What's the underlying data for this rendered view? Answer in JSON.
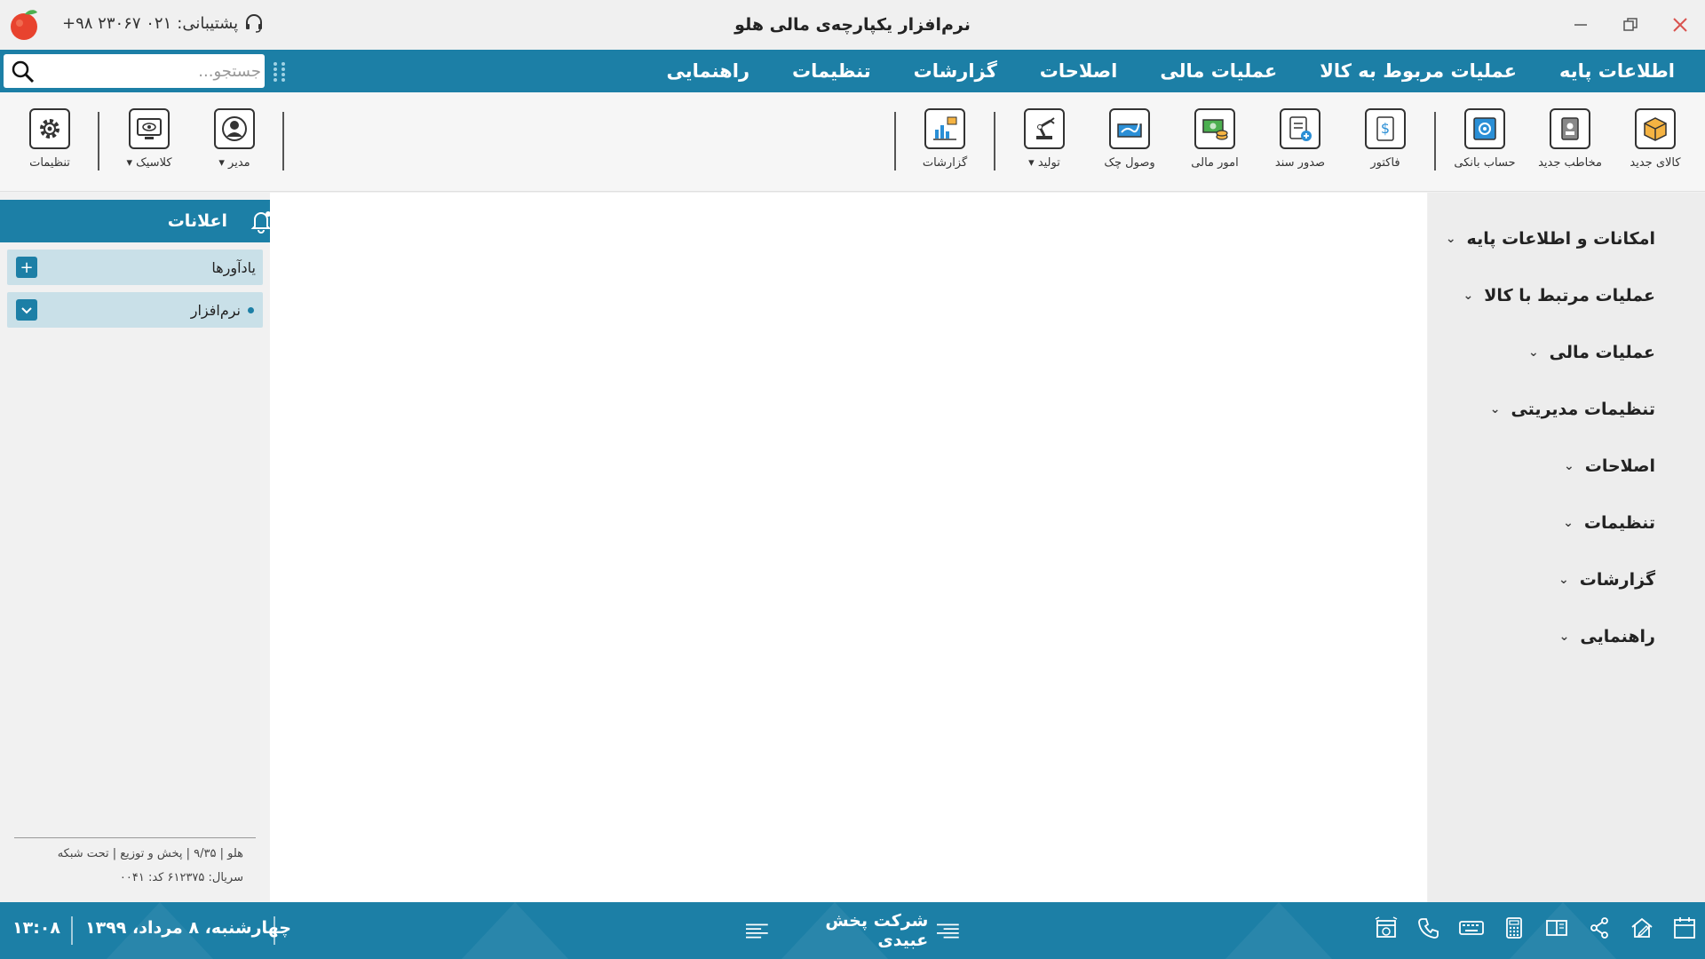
{
  "window": {
    "title": "نرم‌افزار یکپارچه‌ی مالی هلو",
    "support_label": "پشتیبانی:",
    "support_phone": "۰۲۱ ۲۳۰۶۷ ۹۸+"
  },
  "menu": {
    "items": [
      {
        "label": "اطلاعات پایه"
      },
      {
        "label": "عملیات مربوط به کالا"
      },
      {
        "label": "عملیات مالی"
      },
      {
        "label": "اصلاحات"
      },
      {
        "label": "گزارشات"
      },
      {
        "label": "تنظیمات"
      },
      {
        "label": "راهنمایی"
      }
    ],
    "search_placeholder": "جستجو..."
  },
  "toolbar": {
    "items": [
      {
        "label": "کالای جدید",
        "icon": "box-icon"
      },
      {
        "label": "مخاطب جدید",
        "icon": "contact-icon"
      },
      {
        "label": "حساب بانکی",
        "icon": "safe-icon"
      },
      {
        "label": "فاکتور",
        "icon": "invoice-icon"
      },
      {
        "label": "صدور سند",
        "icon": "document-add-icon"
      },
      {
        "label": "امور مالی",
        "icon": "money-icon"
      },
      {
        "label": "وصول چک",
        "icon": "check-icon"
      },
      {
        "label": "تولید",
        "icon": "robot-arm-icon"
      },
      {
        "label": "گزارشات",
        "icon": "report-chart-icon"
      },
      {
        "label": "مدیر",
        "icon": "user-icon"
      },
      {
        "label": "کلاسیک",
        "icon": "monitor-icon"
      },
      {
        "label": "تنظیمات",
        "icon": "gear-icon"
      }
    ]
  },
  "sidepanel": {
    "items": [
      {
        "label": "امکانات و اطلاعات پایه"
      },
      {
        "label": "عملیات مرتبط با کالا"
      },
      {
        "label": "عملیات مالی"
      },
      {
        "label": "تنظیمات مدیریتی"
      },
      {
        "label": "اصلاحات"
      },
      {
        "label": "تنظیمات"
      },
      {
        "label": "گزارشات"
      },
      {
        "label": "راهنمایی"
      }
    ]
  },
  "notifications": {
    "title": "اعلانات",
    "rows": [
      {
        "label": "یادآورها"
      },
      {
        "label": "نرم‌افزار"
      }
    ],
    "footer_line1": "هلو | ۹/۳۵ | پخش و توزیع | تحت شبکه",
    "footer_line2": "سریال: ۶۱۲۳۷۵    کد: ۰۰۴۱"
  },
  "status": {
    "time": "۱۳:۰۸",
    "date": "چهارشنبه، ۸ مرداد، ۱۳۹۹",
    "company": "شرکت پخش عبیدی"
  },
  "colors": {
    "primary": "#1c7fa6",
    "row_bg": "#c9e0e8",
    "close": "#d9534f"
  }
}
